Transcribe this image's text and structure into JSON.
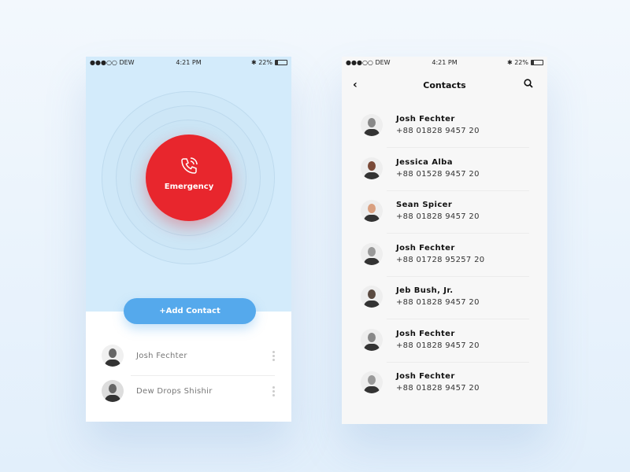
{
  "left": {
    "status": {
      "carrier": "●●●○○ DEW",
      "time": "4:21 PM",
      "battery": "22%"
    },
    "emergency_label": "Emergency",
    "add_contact_label": "+Add Contact",
    "contacts": [
      {
        "name": "Josh Fechter"
      },
      {
        "name": "Dew Drops Shishir"
      }
    ]
  },
  "right": {
    "status": {
      "carrier": "●●●○○ DEW",
      "time": "4:21 PM",
      "battery": "22%"
    },
    "title": "Contacts",
    "contacts": [
      {
        "name": "Josh Fechter",
        "phone": "+88 01828 9457 20",
        "avatar_color": "#888888"
      },
      {
        "name": "Jessica Alba",
        "phone": "+88 01528 9457 20",
        "avatar_color": "#7a4a38"
      },
      {
        "name": "Sean Spicer",
        "phone": "+88 01828 9457 20",
        "avatar_color": "#d9a080"
      },
      {
        "name": "Josh Fechter",
        "phone": "+88 01728 95257 20",
        "avatar_color": "#999999"
      },
      {
        "name": "Jeb Bush, Jr.",
        "phone": "+88 01828 9457 20",
        "avatar_color": "#5a4a40"
      },
      {
        "name": "Josh Fechter",
        "phone": "+88 01828 9457 20",
        "avatar_color": "#888888"
      },
      {
        "name": "Josh Fechter",
        "phone": "+88 01828 9457 20",
        "avatar_color": "#999999"
      }
    ]
  },
  "colors": {
    "emergency": "#e8262d",
    "accent": "#55a9ec",
    "top_bg": "#d3ebfb"
  }
}
